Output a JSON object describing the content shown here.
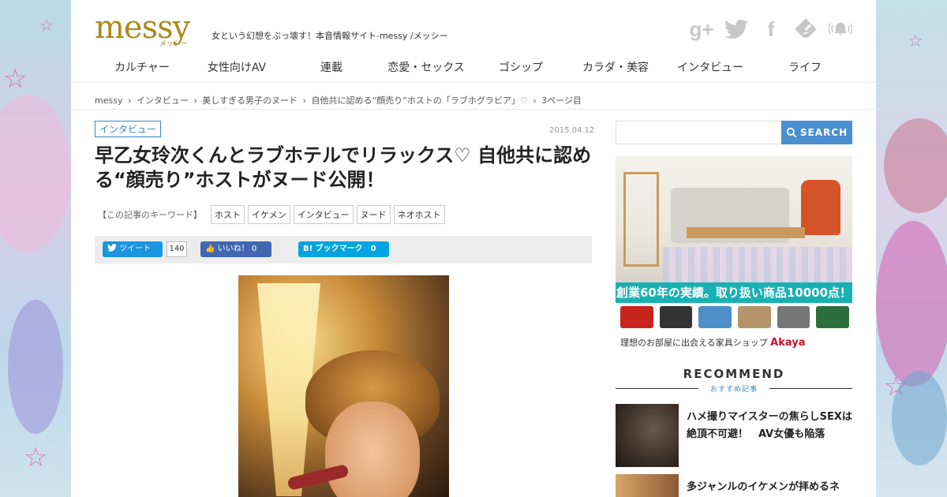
{
  "header": {
    "logo": "messy",
    "logo_sub": "メッシー",
    "tagline": "女という幻想をぶっ壊す！本音情報サイト-messy /メッシー",
    "social_icons": [
      "google-plus-icon",
      "twitter-icon",
      "facebook-icon",
      "feedly-icon",
      "notification-bell-icon"
    ]
  },
  "nav": {
    "items": [
      "カルチャー",
      "女性向けAV",
      "連載",
      "恋愛・セックス",
      "ゴシップ",
      "カラダ・美容",
      "インタビュー",
      "ライフ"
    ]
  },
  "breadcrumb": {
    "items": [
      "messy",
      "›",
      "インタビュー",
      "›",
      "美しすぎる男子のヌード",
      "›",
      "自他共に認める“顔売り”ホストの「ラブホグラビア」♡",
      "›",
      "3ページ目"
    ]
  },
  "article": {
    "category": "インタビュー",
    "date": "2015.04.12",
    "title": "早乙女玲次くんとラブホテルでリラックス♡ 自他共に認める“顔売り”ホストがヌード公開！",
    "keywords_label": "【この記事のキーワード】",
    "keywords": [
      "ホスト",
      "イケメン",
      "インタビュー",
      "ヌード",
      "ネオホスト"
    ],
    "share": {
      "tweet_label": "ツイート",
      "tweet_count": "140",
      "like_label": "いいね！ 0",
      "hatena_label": "B! ブックマーク　0"
    }
  },
  "sidebar": {
    "search_placeholder": "",
    "search_button": "SEARCH",
    "ad": {
      "banner": "創業60年の実績。取り扱い商品10000点！",
      "footer": "理想のお部屋に出会える家具ショップ",
      "brand": "Akaya"
    },
    "recommend": {
      "title": "RECOMMEND",
      "subtitle": "おすすめ記事",
      "items": [
        {
          "text": "ハメ撮りマイスターの焦らしSEXは絶頂不可避！　AV女優も陥落"
        },
        {
          "text": "多ジャンルのイケメンが拝めるネ"
        }
      ]
    }
  },
  "colors": {
    "accent": "#3b86c4",
    "logo": "#a98a1a",
    "search_button": "#4a8fd0",
    "tweet": "#1b95e0",
    "facebook": "#4267b2",
    "hatena": "#00a4de"
  }
}
